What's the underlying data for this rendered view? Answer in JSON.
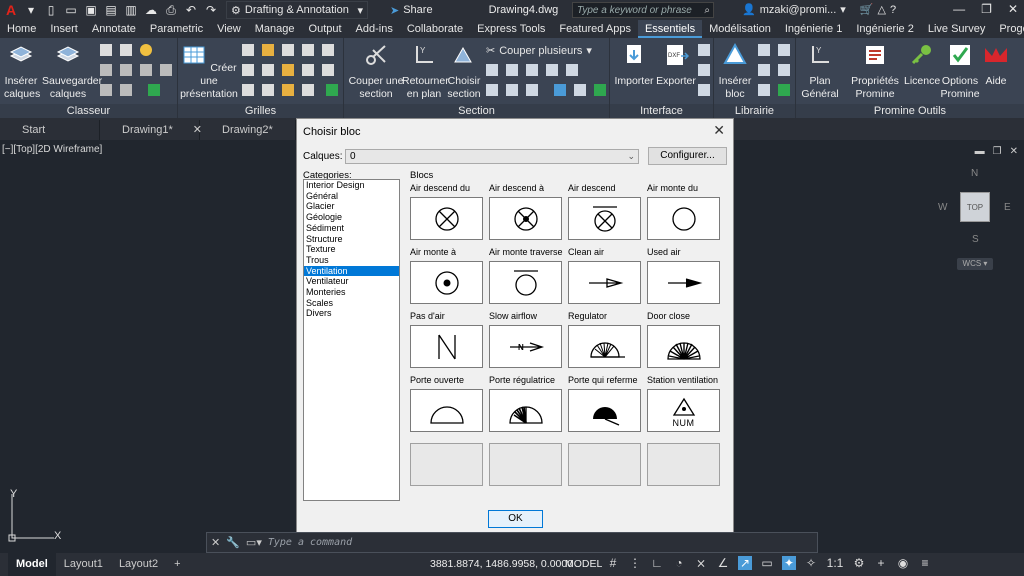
{
  "titlebar": {
    "app_logo": "A",
    "workspace": "Drafting & Annotation",
    "share": "Share",
    "filename": "Drawing4.dwg",
    "search_placeholder": "Type a keyword or phrase",
    "user": "mzaki@promi..."
  },
  "menu": [
    "Home",
    "Insert",
    "Annotate",
    "Parametric",
    "View",
    "Manage",
    "Output",
    "Add-ins",
    "Collaborate",
    "Express Tools",
    "Featured Apps",
    "Essentiels",
    "Modélisation",
    "Ingénierie 1",
    "Ingénierie 2",
    "Live Survey",
    "Progeox"
  ],
  "menu_active": "Essentiels",
  "ribbon": {
    "classeur": {
      "title": "Classeur",
      "inserer": "Insérer calques",
      "sauvegarder": "Sauvegarder calques"
    },
    "grilles": {
      "title": "Grilles",
      "creer": "Créer une présentation"
    },
    "section": {
      "title": "Section",
      "couper": "Couper une section",
      "retourner": "Retourner en plan",
      "choisir": "Choisir section",
      "couper_plusieurs": "Couper plusieurs"
    },
    "interface": {
      "title": "Interface",
      "importer": "Importer",
      "exporter": "Exporter"
    },
    "librairie": {
      "title": "Librairie",
      "inserer_bloc": "Insérer bloc"
    },
    "promine": {
      "title": "Promine Outils",
      "plan": "Plan Général",
      "proprietes": "Propriétés Promine",
      "licence": "Licence",
      "options": "Options Promine",
      "aide": "Aide"
    }
  },
  "doctabs": [
    "Start",
    "Drawing1*",
    "Drawing2*"
  ],
  "viewport": {
    "label": "[−][Top][2D Wireframe]",
    "cube_top": "TOP",
    "n": "N",
    "s": "S",
    "e": "E",
    "w": "W",
    "wcs": "WCS",
    "axis_y": "Y",
    "axis_x": "X"
  },
  "dialog": {
    "title": "Choisir bloc",
    "calques_label": "Calques:",
    "calques_value": "0",
    "configurer": "Configurer...",
    "categories_label": "Categories:",
    "categories": [
      "Interior Design",
      "Général",
      "Glacier",
      "Géologie",
      "Sédiment",
      "Structure",
      "Texture",
      "Trous",
      "Ventilation",
      "Ventilateur",
      "Monteries",
      "Scales",
      "Divers"
    ],
    "selected_category": "Ventilation",
    "blocs_label": "Blocs",
    "blocs": [
      "Air descend du",
      "Air descend à",
      "Air descend",
      "Air monte du",
      "Air monte à",
      "Air monte traverse",
      "Clean air",
      "Used air",
      "Pas d'air",
      "Slow airflow",
      "Regulator",
      "Door close",
      "Porte ouverte",
      "Porte régulatrice",
      "Porte qui referme",
      "Station ventilation"
    ],
    "station_text": "NUM",
    "ok": "OK"
  },
  "cmdline": {
    "placeholder": "Type a command"
  },
  "status": {
    "tabs": [
      "Model",
      "Layout1",
      "Layout2"
    ],
    "coords": "3881.8874, 1486.9958, 0.0000",
    "model": "MODEL",
    "scale": "1:1"
  }
}
